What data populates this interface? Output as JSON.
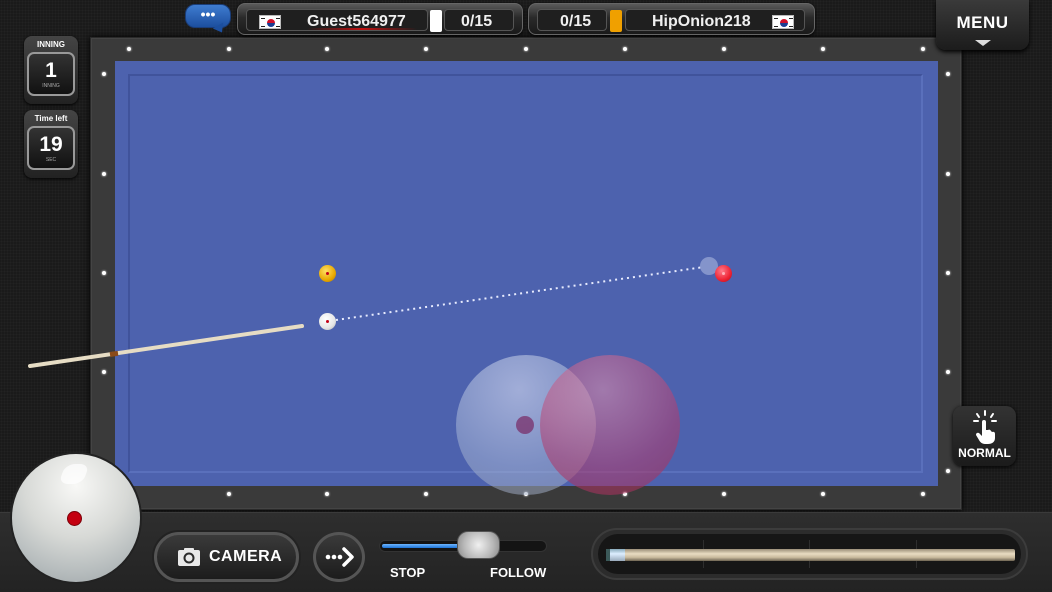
{
  "header": {
    "chat_label": "•••",
    "player_left": {
      "name": "Guest564977",
      "score": "0/15",
      "country": "KR",
      "ball_color": "#ffffff",
      "active": true
    },
    "player_right": {
      "name": "HipOnion218",
      "score": "0/15",
      "country": "KR",
      "ball_color": "#f0a000",
      "active": false
    },
    "menu_label": "MENU"
  },
  "status": {
    "inning_title": "INNING",
    "inning_value": "1",
    "inning_sub": "INNING",
    "time_title": "Time left",
    "time_value": "19",
    "time_sub": "SEC"
  },
  "table": {
    "cloth_color": "#4d62ae",
    "balls": [
      {
        "name": "yellow",
        "color": "#e8a800"
      },
      {
        "name": "white-cue",
        "color": "#f0f0f0"
      },
      {
        "name": "red",
        "color": "#ee2233"
      }
    ],
    "aim_line": "dotted",
    "ghost_ball": true
  },
  "controls": {
    "normal_label": "NORMAL",
    "camera_label": "CAMERA",
    "slider": {
      "left_label": "STOP",
      "right_label": "FOLLOW",
      "value_percent": 50
    },
    "power_percent": 0
  }
}
